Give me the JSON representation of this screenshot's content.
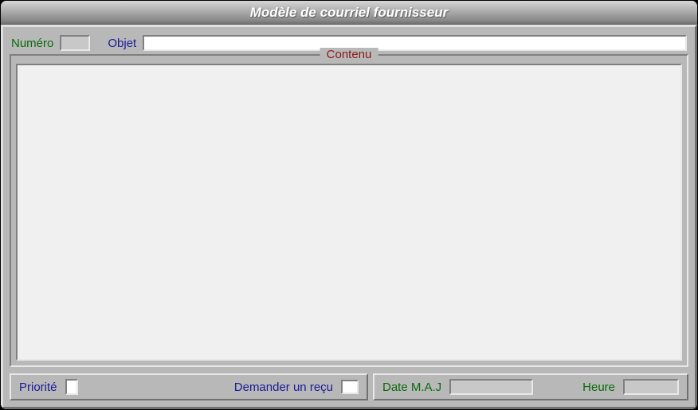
{
  "window": {
    "title": "Modèle de courriel fournisseur"
  },
  "fields": {
    "numero": {
      "label": "Numéro",
      "value": ""
    },
    "objet": {
      "label": "Objet",
      "value": ""
    },
    "contenu": {
      "legend": "Contenu",
      "value": ""
    },
    "priorite": {
      "label": "Priorité",
      "value": ""
    },
    "demander_recu": {
      "label": "Demander un reçu",
      "checked": false
    },
    "date_maj": {
      "label": "Date M.A.J",
      "value": ""
    },
    "heure": {
      "label": "Heure",
      "value": ""
    }
  }
}
